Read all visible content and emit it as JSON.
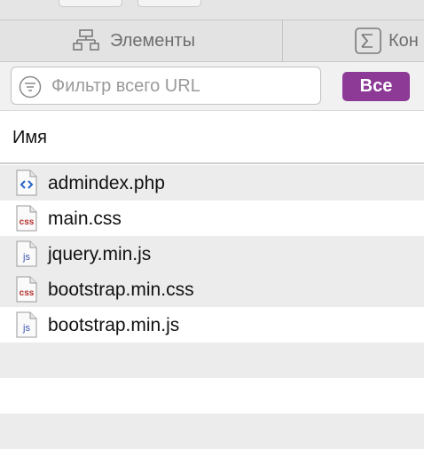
{
  "tabs": [
    {
      "label": "Элементы",
      "icon": "elements-icon"
    },
    {
      "label": "Кон",
      "icon": "console-icon"
    }
  ],
  "filter": {
    "placeholder": "Фильтр всего URL",
    "all_button": "Все"
  },
  "table": {
    "column_name": "Имя",
    "files": [
      {
        "name": "admindex.php",
        "type": "php"
      },
      {
        "name": "main.css",
        "type": "css"
      },
      {
        "name": "jquery.min.js",
        "type": "js"
      },
      {
        "name": "bootstrap.min.css",
        "type": "css"
      },
      {
        "name": "bootstrap.min.js",
        "type": "js"
      }
    ]
  },
  "colors": {
    "accent": "#8c3a96",
    "row_alt": "#ececec"
  }
}
